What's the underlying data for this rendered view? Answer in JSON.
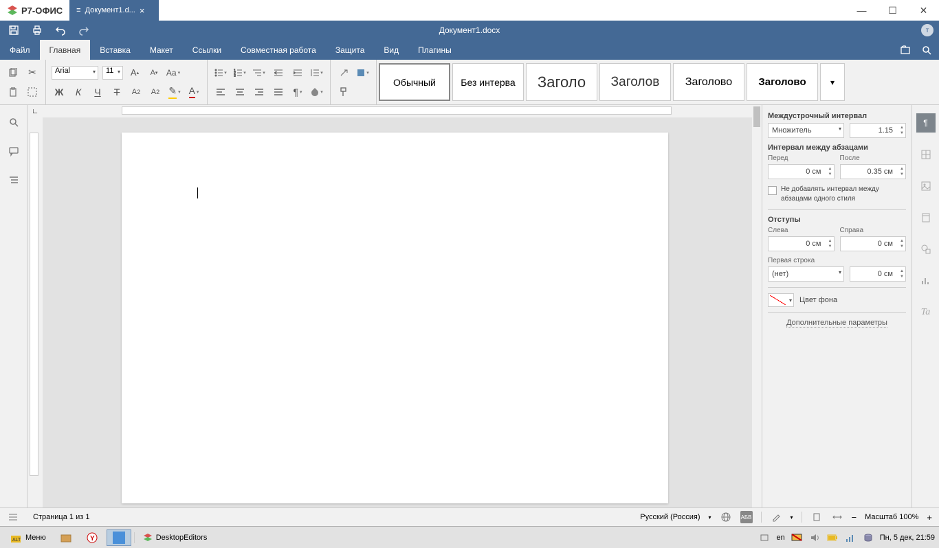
{
  "app": {
    "name": "Р7-ОФИС",
    "tab_title": "Документ1.d...",
    "doc_title": "Документ1.docx",
    "avatar_initial": "т"
  },
  "menu": {
    "file": "Файл",
    "home": "Главная",
    "insert": "Вставка",
    "layout": "Макет",
    "references": "Ссылки",
    "collab": "Совместная работа",
    "protect": "Защита",
    "view": "Вид",
    "plugins": "Плагины"
  },
  "font": {
    "name": "Arial",
    "size": "11"
  },
  "styles": {
    "normal": "Обычный",
    "nospacing": "Без интерва",
    "h1": "Заголо",
    "h2": "Заголов",
    "h3": "Заголово",
    "h4": "Заголово"
  },
  "panel": {
    "linespacing_label": "Междустрочный интервал",
    "linespacing_mode": "Множитель",
    "linespacing_value": "1.15",
    "paraspacing_label": "Интервал между абзацами",
    "before_label": "Перед",
    "before_value": "0 см",
    "after_label": "После",
    "after_value": "0.35 см",
    "no_spacing_same_style": "Не добавлять интервал между абзацами одного стиля",
    "indents_label": "Отступы",
    "left_label": "Слева",
    "left_value": "0 см",
    "right_label": "Справа",
    "right_value": "0 см",
    "firstline_label": "Первая строка",
    "firstline_mode": "(нет)",
    "firstline_value": "0 см",
    "bgcolor_label": "Цвет фона",
    "advanced": "Дополнительные параметры"
  },
  "status": {
    "page": "Страница 1 из 1",
    "lang": "Русский (Россия)",
    "zoom": "Масштаб 100%"
  },
  "taskbar": {
    "menu": "Меню",
    "app": "DesktopEditors",
    "lang": "en",
    "datetime": "Пн,  5 дек, 21:59"
  }
}
